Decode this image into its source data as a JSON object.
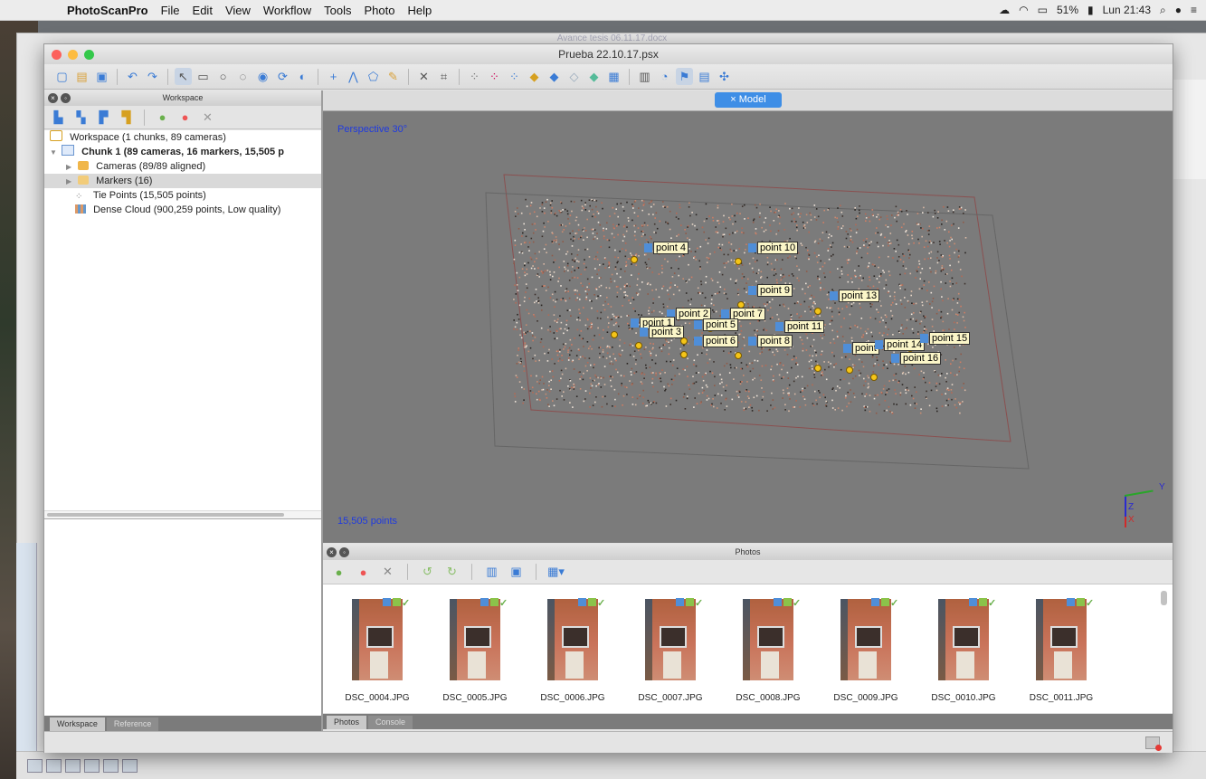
{
  "menubar": {
    "app": "PhotoScanPro",
    "items": [
      "File",
      "Edit",
      "View",
      "Workflow",
      "Tools",
      "Photo",
      "Help"
    ],
    "battery": "51%",
    "clock": "Lun 21:43"
  },
  "background_window": {
    "title": "Avance tesis 06.11.17.docx"
  },
  "window": {
    "title": "Prueba 22.10.17.psx"
  },
  "workspace": {
    "panel_title": "Workspace",
    "tree": [
      {
        "label": "Workspace (1 chunks, 89 cameras)",
        "level": 0
      },
      {
        "label": "Chunk 1 (89 cameras, 16 markers, 15,505 p",
        "level": 1,
        "bold": true
      },
      {
        "label": "Cameras (89/89 aligned)",
        "level": 2
      },
      {
        "label": "Markers (16)",
        "level": 2,
        "selected": true
      },
      {
        "label": "Tie Points (15,505 points)",
        "level": 2
      },
      {
        "label": "Dense Cloud (900,259 points, Low quality)",
        "level": 2
      }
    ],
    "tabs": [
      "Workspace",
      "Reference"
    ],
    "active_tab": "Workspace"
  },
  "model": {
    "tab_label": "Model",
    "projection_label": "Perspective 30°",
    "points_label": "15,505 points",
    "axes": {
      "x": "X",
      "y": "Y",
      "z": "Z"
    },
    "markers": [
      {
        "label": "point 4"
      },
      {
        "label": "point 10"
      },
      {
        "label": "point 9"
      },
      {
        "label": "point 13"
      },
      {
        "label": "point 2"
      },
      {
        "label": "point 7"
      },
      {
        "label": "point 1"
      },
      {
        "label": "point 3"
      },
      {
        "label": "point 5"
      },
      {
        "label": "point 11"
      },
      {
        "label": "point 6"
      },
      {
        "label": "point 8"
      },
      {
        "label": "point"
      },
      {
        "label": "point 14"
      },
      {
        "label": "point 15"
      },
      {
        "label": "point 16"
      }
    ]
  },
  "photos": {
    "panel_title": "Photos",
    "items": [
      "DSC_0004.JPG",
      "DSC_0005.JPG",
      "DSC_0006.JPG",
      "DSC_0007.JPG",
      "DSC_0008.JPG",
      "DSC_0009.JPG",
      "DSC_0010.JPG",
      "DSC_0011.JPG"
    ],
    "tabs": [
      "Photos",
      "Console"
    ],
    "active_tab": "Photos"
  },
  "colors": {
    "accent_tab": "#3e8ee6",
    "viewport_bg": "#7b7b7b",
    "marker_flag": "#4f8ed8",
    "marker_dot": "#f5c518",
    "label_blue": "#1f3ae0"
  }
}
